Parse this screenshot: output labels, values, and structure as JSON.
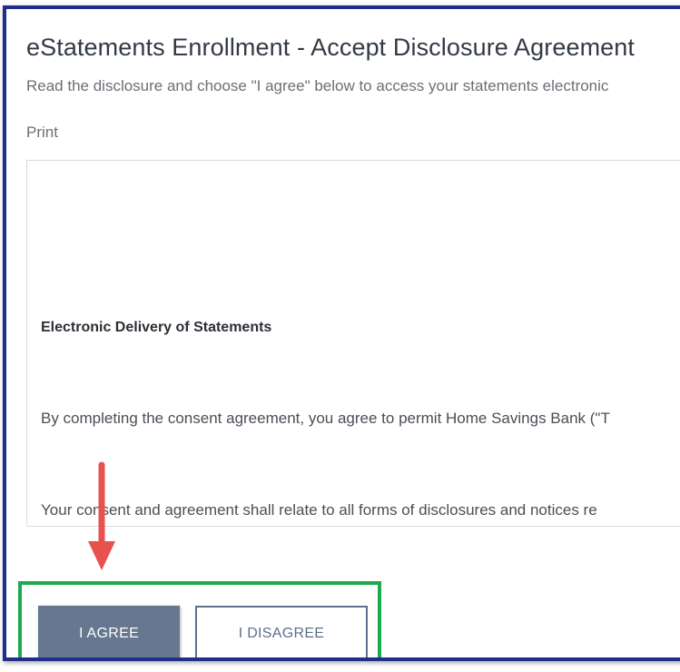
{
  "header": {
    "title": "eStatements Enrollment - Accept Disclosure Agreement",
    "subtitle": "Read the disclosure and choose \"I agree\" below to access your statements electronic",
    "print_label": "Print"
  },
  "disclosure": {
    "heading": "Electronic Delivery of Statements",
    "paragraphs": [
      "By completing the consent agreement, you agree to permit Home Savings Bank (\"T",
      "Your consent and agreement shall relate to all forms of disclosures and notices re"
    ]
  },
  "actions": {
    "agree_label": "I AGREE",
    "disagree_label": "I DISAGREE"
  },
  "colors": {
    "frame_border": "#1f2e8a",
    "highlight_border": "#1fa84f",
    "arrow": "#e8524e",
    "agree_bg": "#66778f"
  }
}
